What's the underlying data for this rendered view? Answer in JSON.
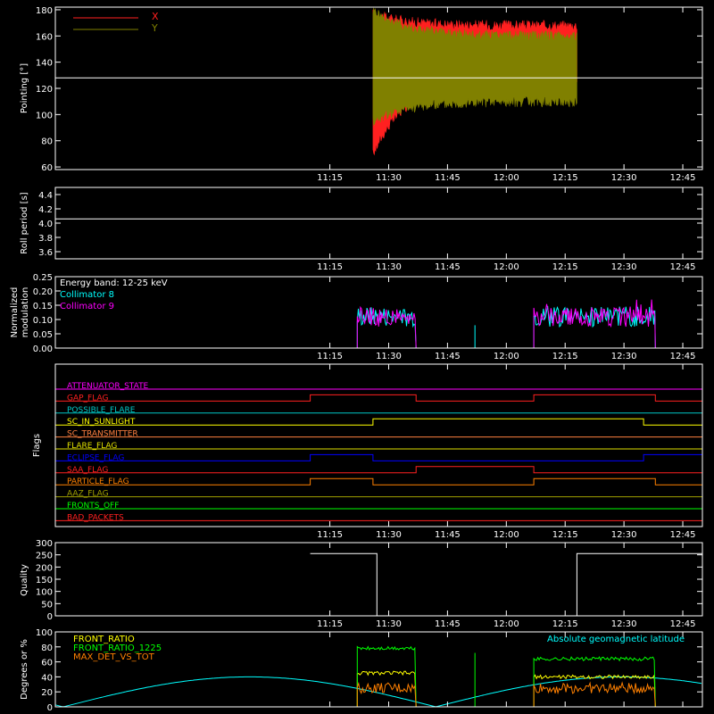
{
  "figure": {
    "time_ticks": [
      "11:15",
      "11:30",
      "11:45",
      "12:00",
      "12:15",
      "12:30",
      "12:45"
    ]
  },
  "chart_data": [
    {
      "type": "line",
      "ylabel": "Pointing [°]",
      "ylim": [
        58,
        182
      ],
      "yticks": [
        "60",
        "80",
        "100",
        "120",
        "140",
        "160",
        "180"
      ],
      "series": [
        {
          "name": "X",
          "color": "#ff2020",
          "active_span": [
            "11:26",
            "12:18"
          ],
          "start_min": 70,
          "start_max": 177,
          "end_min": 128,
          "end_max": 168
        },
        {
          "name": "Y",
          "color": "#808000",
          "active_span": [
            "11:26",
            "12:18"
          ],
          "start_min": 95,
          "start_max": 180,
          "end_min": 110,
          "end_max": 160
        }
      ],
      "reference_line": 128
    },
    {
      "type": "line",
      "ylabel": "Roll period [s]",
      "ylim": [
        3.5,
        4.5
      ],
      "yticks": [
        "3.6",
        "3.8",
        "4.0",
        "4.2",
        "4.4"
      ],
      "series": [
        {
          "color": "#ffffff",
          "value": 4.06
        }
      ]
    },
    {
      "type": "line",
      "ylabel": "Normalized modulation",
      "ylabel_lines": [
        "Normalized",
        "modulation"
      ],
      "ylim": [
        0,
        0.25
      ],
      "yticks": [
        "0.00",
        "0.05",
        "0.10",
        "0.15",
        "0.20",
        "0.25"
      ],
      "legend": [
        "Energy band: 12-25 keV",
        "Collimator 8",
        "Collimator 9"
      ],
      "legend_colors": [
        "#ffffff",
        "#00ffff",
        "#ff00ff"
      ],
      "series": [
        {
          "name": "Collimator 8",
          "color": "#00ffff",
          "active_spans": [
            [
              "11:22",
              "11:37"
            ],
            [
              "12:07",
              "12:38"
            ]
          ],
          "level": 0.11
        },
        {
          "name": "Collimator 9",
          "color": "#ff00ff",
          "active_spans": [
            [
              "11:22",
              "11:37"
            ],
            [
              "12:07",
              "12:38"
            ]
          ],
          "level": 0.11
        }
      ],
      "spike": {
        "time": "11:52",
        "value": 0.08
      }
    },
    {
      "type": "line",
      "ylabel": "Flags",
      "flags": [
        {
          "label": "ATTENUATOR_STATE",
          "color": "#ff00ff",
          "highs": []
        },
        {
          "label": "GAP_FLAG",
          "color": "#ff2020",
          "highs": [
            [
              "11:10",
              "11:37"
            ],
            [
              "12:07",
              "12:38"
            ]
          ],
          "low_spans": [
            [
              "11:37",
              "12:07"
            ],
            [
              "12:38",
              "12:50"
            ]
          ]
        },
        {
          "label": "POSSIBLE_FLARE",
          "color": "#00c8c8",
          "highs": []
        },
        {
          "label": "SC_IN_SUNLIGHT",
          "color": "#ffff00",
          "highs": [
            [
              "11:26",
              "12:35"
            ]
          ]
        },
        {
          "label": "SC_TRANSMITTER",
          "color": "#ff8040",
          "highs": []
        },
        {
          "label": "FLARE_FLAG",
          "color": "#e0e000",
          "highs": []
        },
        {
          "label": "ECLIPSE_FLAG",
          "color": "#0000ff",
          "highs": [
            [
              "11:10",
              "11:26"
            ],
            [
              "12:35",
              "12:50"
            ]
          ]
        },
        {
          "label": "SAA_FLAG",
          "color": "#ff2020",
          "highs": [
            [
              "11:37",
              "12:07"
            ]
          ]
        },
        {
          "label": "PARTICLE_FLAG",
          "color": "#ff8000",
          "highs": [
            [
              "11:10",
              "11:26"
            ],
            [
              "12:07",
              "12:38"
            ]
          ]
        },
        {
          "label": "AAZ_FLAG",
          "color": "#a0a000",
          "highs": []
        },
        {
          "label": "FRONTS_OFF",
          "color": "#00ff00",
          "highs": []
        },
        {
          "label": "BAD_PACKETS",
          "color": "#ff2020",
          "highs": []
        }
      ]
    },
    {
      "type": "line",
      "ylabel": "Quality",
      "ylim": [
        0,
        300
      ],
      "yticks": [
        "0",
        "50",
        "100",
        "150",
        "200",
        "250",
        "300"
      ],
      "series": [
        {
          "color": "#ffffff",
          "steps": [
            [
              "11:10",
              255
            ],
            [
              "11:27",
              0
            ],
            [
              "12:18",
              255
            ],
            [
              "12:50",
              255
            ]
          ]
        }
      ]
    },
    {
      "type": "line",
      "ylabel": "Degrees or %",
      "ylim": [
        0,
        100
      ],
      "yticks": [
        "0",
        "20",
        "40",
        "60",
        "80",
        "100"
      ],
      "legend": [
        "FRONT_RATIO",
        "FRONT_RATIO_1225",
        "MAX_DET_VS_TOT"
      ],
      "legend_colors": [
        "#ffff00",
        "#00ff00",
        "#ff8000"
      ],
      "annotation": "Absolute geomagnetic latitude",
      "annotation_color": "#00ffff",
      "series": [
        {
          "name": "FRONT_RATIO",
          "color": "#ffff00",
          "spans": [
            [
              "11:22",
              "11:37",
              45
            ],
            [
              "12:07",
              "12:38",
              40
            ]
          ]
        },
        {
          "name": "FRONT_RATIO_1225",
          "color": "#00ff00",
          "spans": [
            [
              "11:22",
              "11:37",
              78
            ],
            [
              "12:07",
              "12:38",
              64
            ]
          ]
        },
        {
          "name": "MAX_DET_VS_TOT",
          "color": "#ff8000",
          "spans": [
            [
              "11:22",
              "11:37",
              25
            ],
            [
              "12:07",
              "12:38",
              25
            ]
          ]
        },
        {
          "name": "Absolute geomagnetic latitude",
          "color": "#00ffff"
        }
      ]
    }
  ]
}
